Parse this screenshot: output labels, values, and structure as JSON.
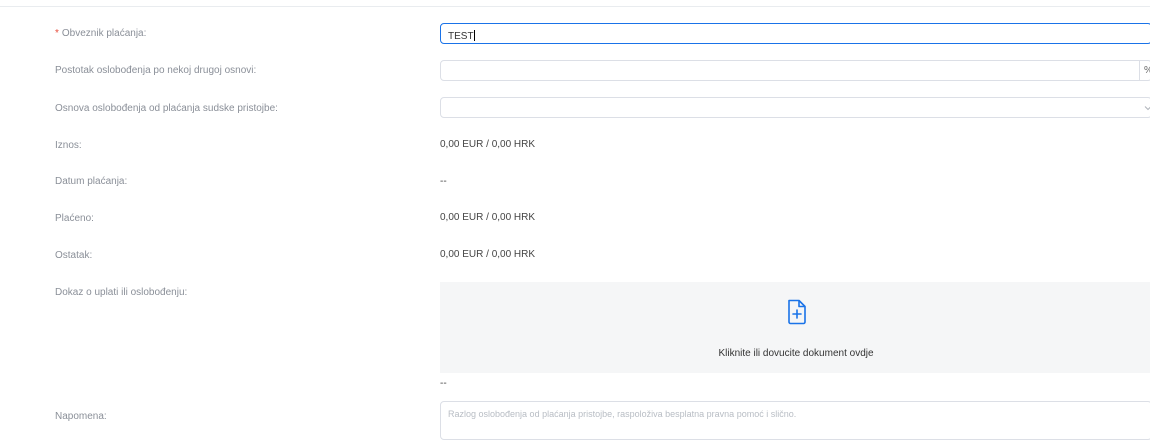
{
  "fields": {
    "obveznik": {
      "label": "Obveznik plaćanja:",
      "required_mark": "*",
      "value": "TEST"
    },
    "postotak": {
      "label": "Postotak oslobođenja po nekoj drugoj osnovi:",
      "value": "",
      "suffix": "%"
    },
    "osnova": {
      "label": "Osnova oslobođenja od plaćanja sudske pristojbe:",
      "value": ""
    },
    "iznos": {
      "label": "Iznos:",
      "value": "0,00 EUR / 0,00 HRK"
    },
    "datum": {
      "label": "Datum plaćanja:",
      "value": "--"
    },
    "placeno": {
      "label": "Plaćeno:",
      "value": "0,00 EUR / 0,00 HRK"
    },
    "ostatak": {
      "label": "Ostatak:",
      "value": "0,00 EUR / 0,00 HRK"
    },
    "dokaz": {
      "label": "Dokaz o uplati ili oslobođenju:",
      "upload_text": "Kliknite ili dovucite dokument ovdje",
      "after_value": "--"
    },
    "napomena": {
      "label": "Napomena:",
      "placeholder": "Razlog oslobođenja od plaćanja pristojbe, raspoloživa besplatna pravna pomoć i slično."
    }
  },
  "icons": {
    "upload": "file-plus-icon",
    "dropdown": "chevron-down-icon"
  },
  "colors": {
    "accent": "#1a73e8",
    "required": "#e74c3c"
  }
}
